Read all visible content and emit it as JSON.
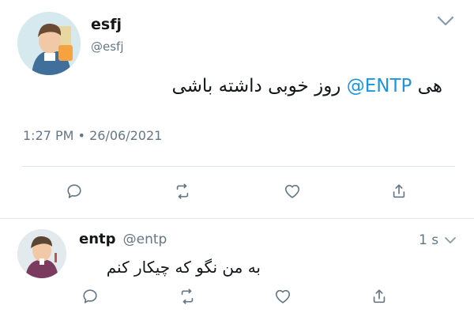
{
  "main_tweet": {
    "display_name": "esfj",
    "handle": "@esfj",
    "text_prefix": "هی ",
    "mention": "@ENTP",
    "text_suffix": " روز خوبی داشته باشی",
    "timestamp": "1:27 PM • 26/06/2021"
  },
  "reply": {
    "display_name": "entp",
    "handle": "@entp",
    "age": "1 s",
    "text": "به من نگو که چیکار کنم"
  },
  "colors": {
    "mention": "#1b95e0",
    "muted": "#657786",
    "divider": "#e1e8ed"
  },
  "icons": [
    "chevron-down-icon",
    "reply-icon",
    "retweet-icon",
    "like-icon",
    "share-icon"
  ]
}
